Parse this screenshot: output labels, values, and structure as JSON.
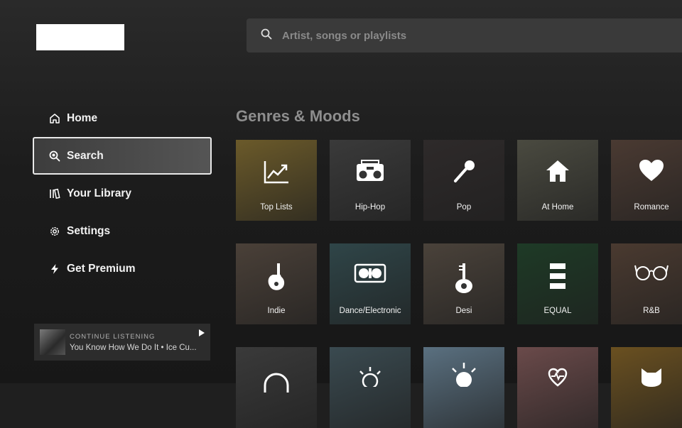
{
  "search": {
    "placeholder": "Artist, songs or playlists"
  },
  "nav": {
    "items": [
      {
        "label": "Home"
      },
      {
        "label": "Search"
      },
      {
        "label": "Your Library"
      },
      {
        "label": "Settings"
      },
      {
        "label": "Get Premium"
      }
    ]
  },
  "continue": {
    "label": "CONTINUE LISTENING",
    "track": "You Know How We Do It • Ice Cu..."
  },
  "genres": {
    "title": "Genres & Moods",
    "tiles": [
      {
        "label": "Top Lists",
        "color": "#6b5a2a"
      },
      {
        "label": "Hip-Hop",
        "color": "#3a3a3a"
      },
      {
        "label": "Pop",
        "color": "#2e2a2a"
      },
      {
        "label": "At Home",
        "color": "#4a4a40"
      },
      {
        "label": "Romance",
        "color": "#4a3a32"
      },
      {
        "label": "Indie",
        "color": "#4a4038"
      },
      {
        "label": "Dance/Electronic",
        "color": "#2f4548"
      },
      {
        "label": "Desi",
        "color": "#4a423a"
      },
      {
        "label": "EQUAL",
        "color": "#1e3a26"
      },
      {
        "label": "R&B",
        "color": "#4a3a30"
      },
      {
        "label": "",
        "color": "#3a3a3a"
      },
      {
        "label": "",
        "color": "#3a4a50"
      },
      {
        "label": "",
        "color": "#5a7080"
      },
      {
        "label": "",
        "color": "#6a4a4a"
      },
      {
        "label": "",
        "color": "#6a5020"
      }
    ]
  }
}
